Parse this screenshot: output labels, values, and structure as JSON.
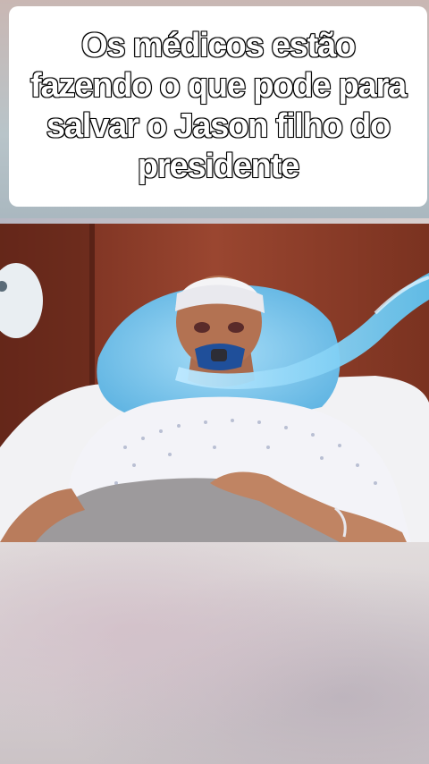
{
  "caption": {
    "text": "Os médicos estão fazendo o que pode para salvar o Jason filho do presidente"
  },
  "scene": {
    "description_icon": "hospital-bed-scene"
  },
  "colors": {
    "wall": "#8a3a26",
    "pillow": "#7cc4ec",
    "tube": "#6cc8f0",
    "gown": "#f3f3f8",
    "blanket": "#9d9a9c"
  }
}
